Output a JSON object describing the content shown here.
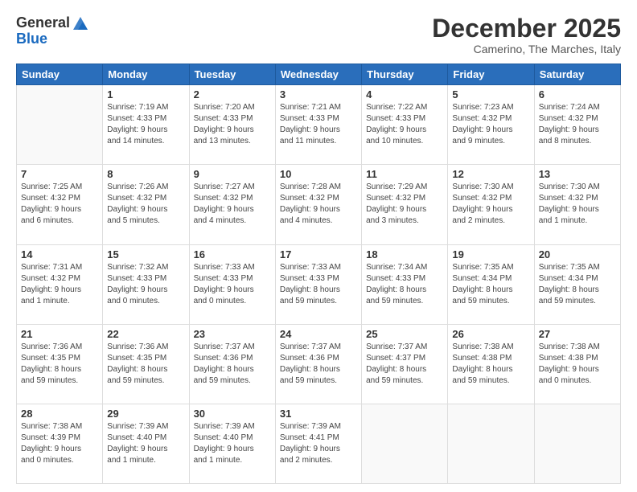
{
  "logo": {
    "general": "General",
    "blue": "Blue"
  },
  "header": {
    "month": "December 2025",
    "location": "Camerino, The Marches, Italy"
  },
  "weekdays": [
    "Sunday",
    "Monday",
    "Tuesday",
    "Wednesday",
    "Thursday",
    "Friday",
    "Saturday"
  ],
  "weeks": [
    [
      {
        "day": "",
        "info": ""
      },
      {
        "day": "1",
        "info": "Sunrise: 7:19 AM\nSunset: 4:33 PM\nDaylight: 9 hours\nand 14 minutes."
      },
      {
        "day": "2",
        "info": "Sunrise: 7:20 AM\nSunset: 4:33 PM\nDaylight: 9 hours\nand 13 minutes."
      },
      {
        "day": "3",
        "info": "Sunrise: 7:21 AM\nSunset: 4:33 PM\nDaylight: 9 hours\nand 11 minutes."
      },
      {
        "day": "4",
        "info": "Sunrise: 7:22 AM\nSunset: 4:33 PM\nDaylight: 9 hours\nand 10 minutes."
      },
      {
        "day": "5",
        "info": "Sunrise: 7:23 AM\nSunset: 4:32 PM\nDaylight: 9 hours\nand 9 minutes."
      },
      {
        "day": "6",
        "info": "Sunrise: 7:24 AM\nSunset: 4:32 PM\nDaylight: 9 hours\nand 8 minutes."
      }
    ],
    [
      {
        "day": "7",
        "info": "Sunrise: 7:25 AM\nSunset: 4:32 PM\nDaylight: 9 hours\nand 6 minutes."
      },
      {
        "day": "8",
        "info": "Sunrise: 7:26 AM\nSunset: 4:32 PM\nDaylight: 9 hours\nand 5 minutes."
      },
      {
        "day": "9",
        "info": "Sunrise: 7:27 AM\nSunset: 4:32 PM\nDaylight: 9 hours\nand 4 minutes."
      },
      {
        "day": "10",
        "info": "Sunrise: 7:28 AM\nSunset: 4:32 PM\nDaylight: 9 hours\nand 4 minutes."
      },
      {
        "day": "11",
        "info": "Sunrise: 7:29 AM\nSunset: 4:32 PM\nDaylight: 9 hours\nand 3 minutes."
      },
      {
        "day": "12",
        "info": "Sunrise: 7:30 AM\nSunset: 4:32 PM\nDaylight: 9 hours\nand 2 minutes."
      },
      {
        "day": "13",
        "info": "Sunrise: 7:30 AM\nSunset: 4:32 PM\nDaylight: 9 hours\nand 1 minute."
      }
    ],
    [
      {
        "day": "14",
        "info": "Sunrise: 7:31 AM\nSunset: 4:32 PM\nDaylight: 9 hours\nand 1 minute."
      },
      {
        "day": "15",
        "info": "Sunrise: 7:32 AM\nSunset: 4:33 PM\nDaylight: 9 hours\nand 0 minutes."
      },
      {
        "day": "16",
        "info": "Sunrise: 7:33 AM\nSunset: 4:33 PM\nDaylight: 9 hours\nand 0 minutes."
      },
      {
        "day": "17",
        "info": "Sunrise: 7:33 AM\nSunset: 4:33 PM\nDaylight: 8 hours\nand 59 minutes."
      },
      {
        "day": "18",
        "info": "Sunrise: 7:34 AM\nSunset: 4:33 PM\nDaylight: 8 hours\nand 59 minutes."
      },
      {
        "day": "19",
        "info": "Sunrise: 7:35 AM\nSunset: 4:34 PM\nDaylight: 8 hours\nand 59 minutes."
      },
      {
        "day": "20",
        "info": "Sunrise: 7:35 AM\nSunset: 4:34 PM\nDaylight: 8 hours\nand 59 minutes."
      }
    ],
    [
      {
        "day": "21",
        "info": "Sunrise: 7:36 AM\nSunset: 4:35 PM\nDaylight: 8 hours\nand 59 minutes."
      },
      {
        "day": "22",
        "info": "Sunrise: 7:36 AM\nSunset: 4:35 PM\nDaylight: 8 hours\nand 59 minutes."
      },
      {
        "day": "23",
        "info": "Sunrise: 7:37 AM\nSunset: 4:36 PM\nDaylight: 8 hours\nand 59 minutes."
      },
      {
        "day": "24",
        "info": "Sunrise: 7:37 AM\nSunset: 4:36 PM\nDaylight: 8 hours\nand 59 minutes."
      },
      {
        "day": "25",
        "info": "Sunrise: 7:37 AM\nSunset: 4:37 PM\nDaylight: 8 hours\nand 59 minutes."
      },
      {
        "day": "26",
        "info": "Sunrise: 7:38 AM\nSunset: 4:38 PM\nDaylight: 8 hours\nand 59 minutes."
      },
      {
        "day": "27",
        "info": "Sunrise: 7:38 AM\nSunset: 4:38 PM\nDaylight: 9 hours\nand 0 minutes."
      }
    ],
    [
      {
        "day": "28",
        "info": "Sunrise: 7:38 AM\nSunset: 4:39 PM\nDaylight: 9 hours\nand 0 minutes."
      },
      {
        "day": "29",
        "info": "Sunrise: 7:39 AM\nSunset: 4:40 PM\nDaylight: 9 hours\nand 1 minute."
      },
      {
        "day": "30",
        "info": "Sunrise: 7:39 AM\nSunset: 4:40 PM\nDaylight: 9 hours\nand 1 minute."
      },
      {
        "day": "31",
        "info": "Sunrise: 7:39 AM\nSunset: 4:41 PM\nDaylight: 9 hours\nand 2 minutes."
      },
      {
        "day": "",
        "info": ""
      },
      {
        "day": "",
        "info": ""
      },
      {
        "day": "",
        "info": ""
      }
    ]
  ]
}
